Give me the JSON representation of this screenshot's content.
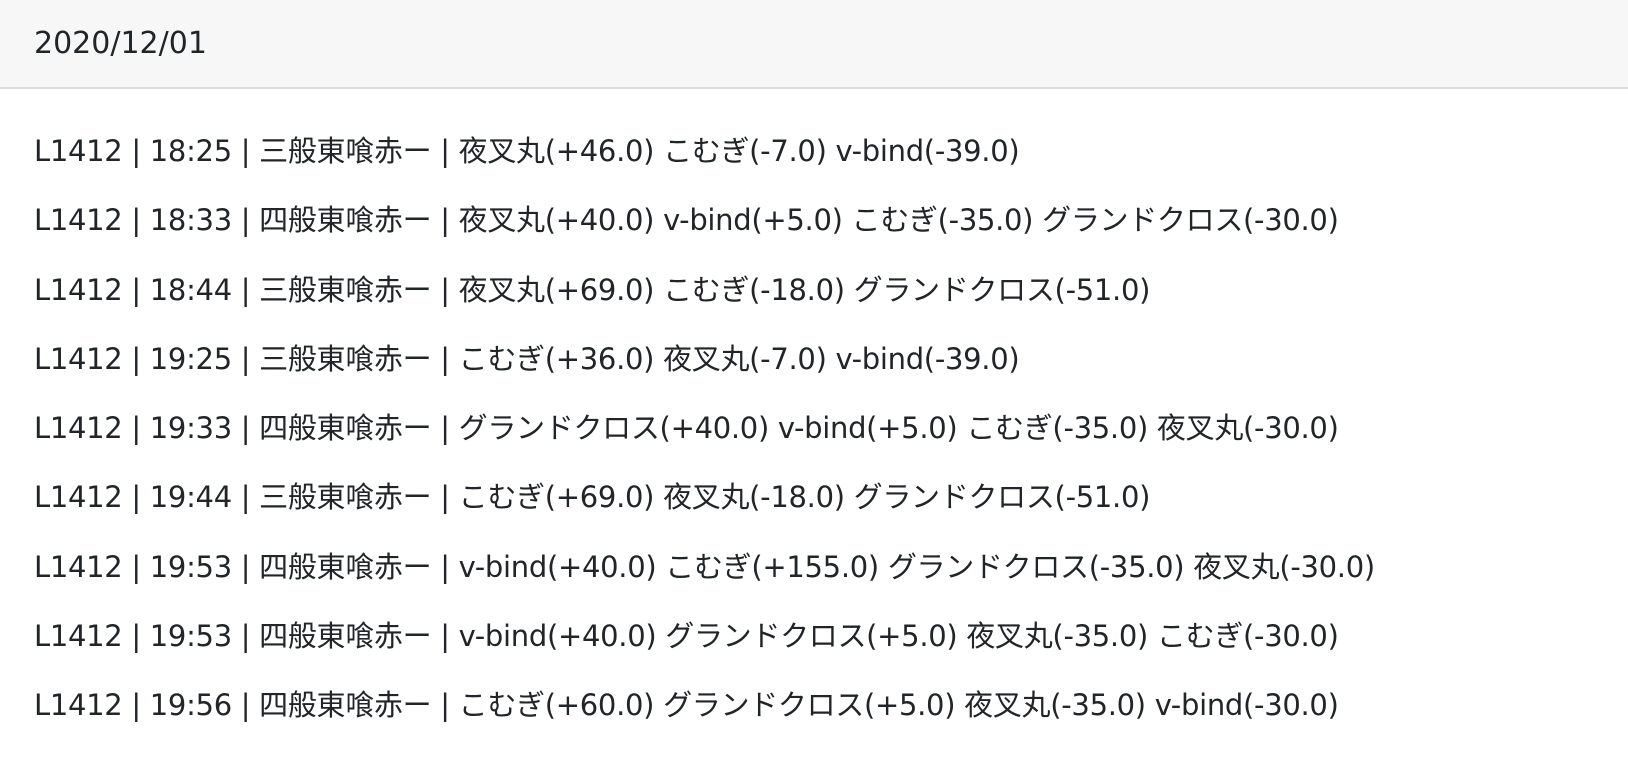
{
  "header": {
    "date": "2020/12/01"
  },
  "records": [
    "L1412 | 18:25 | 三般東喰赤ー | 夜叉丸(+46.0) こむぎ(-7.0) v-bind(-39.0)",
    "L1412 | 18:33 | 四般東喰赤ー | 夜叉丸(+40.0) v-bind(+5.0) こむぎ(-35.0) グランドクロス(-30.0)",
    "L1412 | 18:44 | 三般東喰赤ー | 夜叉丸(+69.0) こむぎ(-18.0) グランドクロス(-51.0)",
    "L1412 | 19:25 | 三般東喰赤ー | こむぎ(+36.0) 夜叉丸(-7.0) v-bind(-39.0)",
    "L1412 | 19:33 | 四般東喰赤ー | グランドクロス(+40.0) v-bind(+5.0) こむぎ(-35.0) 夜叉丸(-30.0)",
    "L1412 | 19:44 | 三般東喰赤ー | こむぎ(+69.0) 夜叉丸(-18.0) グランドクロス(-51.0)",
    "L1412 | 19:53 | 四般東喰赤ー | v-bind(+40.0) こむぎ(+155.0) グランドクロス(-35.0) 夜叉丸(-30.0)",
    "L1412 | 19:53 | 四般東喰赤ー | v-bind(+40.0) グランドクロス(+5.0) 夜叉丸(-35.0) こむぎ(-30.0)",
    "L1412 | 19:56 | 四般東喰赤ー | こむぎ(+60.0) グランドクロス(+5.0) 夜叉丸(-35.0) v-bind(-30.0)"
  ]
}
